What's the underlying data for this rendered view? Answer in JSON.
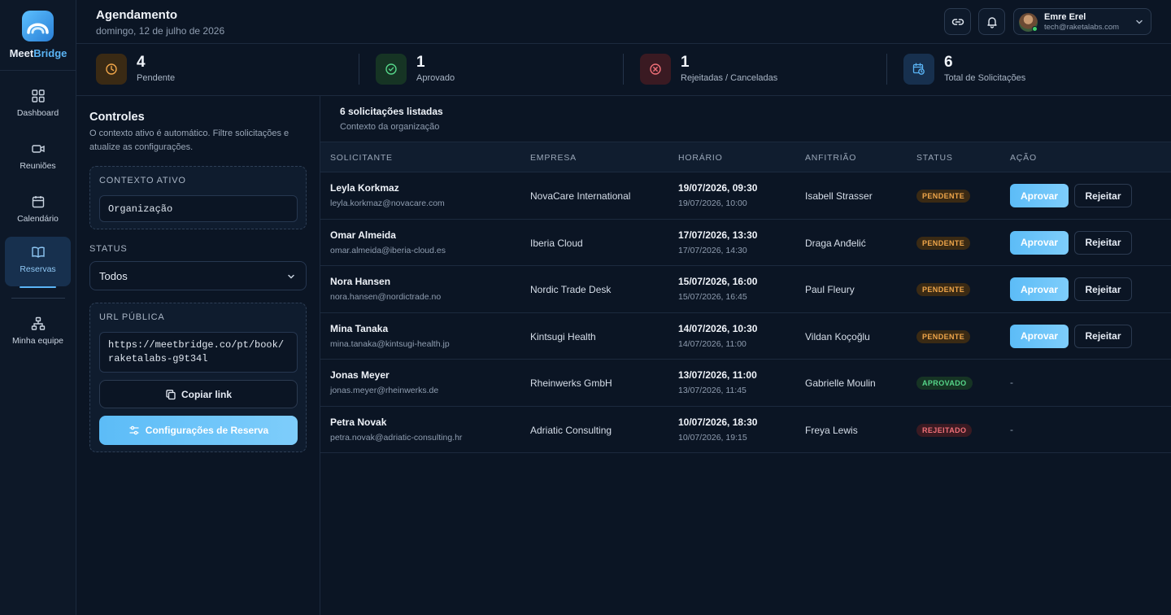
{
  "brand": {
    "name_part1": "Meet",
    "name_part2": "Bridge",
    "accent_color": "#5ab4f5"
  },
  "sidebar": {
    "items": [
      {
        "label": "Dashboard",
        "icon": "grid-icon"
      },
      {
        "label": "Reuniões",
        "icon": "video-icon"
      },
      {
        "label": "Calendário",
        "icon": "calendar-icon"
      },
      {
        "label": "Reservas",
        "icon": "book-icon",
        "active": true
      },
      {
        "label": "Minha equipe",
        "icon": "team-icon"
      }
    ]
  },
  "header": {
    "title": "Agendamento",
    "date": "domingo, 12 de julho de 2026",
    "user": {
      "name": "Emre Erel",
      "email": "tech@raketalabs.com"
    }
  },
  "stats": [
    {
      "value": "4",
      "label": "Pendente",
      "icon": "clock-icon",
      "color": "#f0a64a"
    },
    {
      "value": "1",
      "label": "Aprovado",
      "icon": "check-circle-icon",
      "color": "#56d68a"
    },
    {
      "value": "1",
      "label": "Rejeitadas / Canceladas",
      "icon": "x-circle-icon",
      "color": "#f07078"
    },
    {
      "value": "6",
      "label": "Total de Solicitações",
      "icon": "calendar-clock-icon",
      "color": "#5ab4f5"
    }
  ],
  "controls": {
    "title": "Controles",
    "description": "O contexto ativo é automático. Filtre solicitações e atualize as configurações.",
    "context_label": "CONTEXTO ATIVO",
    "context_value": "Organização",
    "status_label": "STATUS",
    "status_value": "Todos",
    "url_label": "URL PÚBLICA",
    "url_line1": "https://meetbridge.co/pt/book/",
    "url_line2": "raketalabs-g9t34l",
    "copy_label": "Copiar link",
    "config_label": "Configurações de Reserva"
  },
  "list": {
    "title": "6 solicitações listadas",
    "subtitle": "Contexto da organização",
    "columns": [
      "SOLICITANTE",
      "EMPRESA",
      "HORÁRIO",
      "ANFITRIÃO",
      "STATUS",
      "AÇÃO"
    ],
    "approve_label": "Aprovar",
    "reject_label": "Rejeitar",
    "rows": [
      {
        "name": "Leyla Korkmaz",
        "email": "leyla.korkmaz@novacare.com",
        "company": "NovaCare International",
        "start": "19/07/2026, 09:30",
        "end": "19/07/2026, 10:00",
        "host": "Isabell Strasser",
        "status": "PENDENTE",
        "kind": "pend",
        "action": ""
      },
      {
        "name": "Omar Almeida",
        "email": "omar.almeida@iberia-cloud.es",
        "company": "Iberia Cloud",
        "start": "17/07/2026, 13:30",
        "end": "17/07/2026, 14:30",
        "host": "Draga Anđelić",
        "status": "PENDENTE",
        "kind": "pend",
        "action": ""
      },
      {
        "name": "Nora Hansen",
        "email": "nora.hansen@nordictrade.no",
        "company": "Nordic Trade Desk",
        "start": "15/07/2026, 16:00",
        "end": "15/07/2026, 16:45",
        "host": "Paul Fleury",
        "status": "PENDENTE",
        "kind": "pend",
        "action": ""
      },
      {
        "name": "Mina Tanaka",
        "email": "mina.tanaka@kintsugi-health.jp",
        "company": "Kintsugi Health",
        "start": "14/07/2026, 10:30",
        "end": "14/07/2026, 11:00",
        "host": "Vildan Koçoğlu",
        "status": "PENDENTE",
        "kind": "pend",
        "action": ""
      },
      {
        "name": "Jonas Meyer",
        "email": "jonas.meyer@rheinwerks.de",
        "company": "Rheinwerks GmbH",
        "start": "13/07/2026, 11:00",
        "end": "13/07/2026, 11:45",
        "host": "Gabrielle Moulin",
        "status": "APROVADO",
        "kind": "aprov",
        "action": "-"
      },
      {
        "name": "Petra Novak",
        "email": "petra.novak@adriatic-consulting.hr",
        "company": "Adriatic Consulting",
        "start": "10/07/2026, 18:30",
        "end": "10/07/2026, 19:15",
        "host": "Freya Lewis",
        "status": "REJEITADO",
        "kind": "rej",
        "action": "-"
      }
    ]
  }
}
